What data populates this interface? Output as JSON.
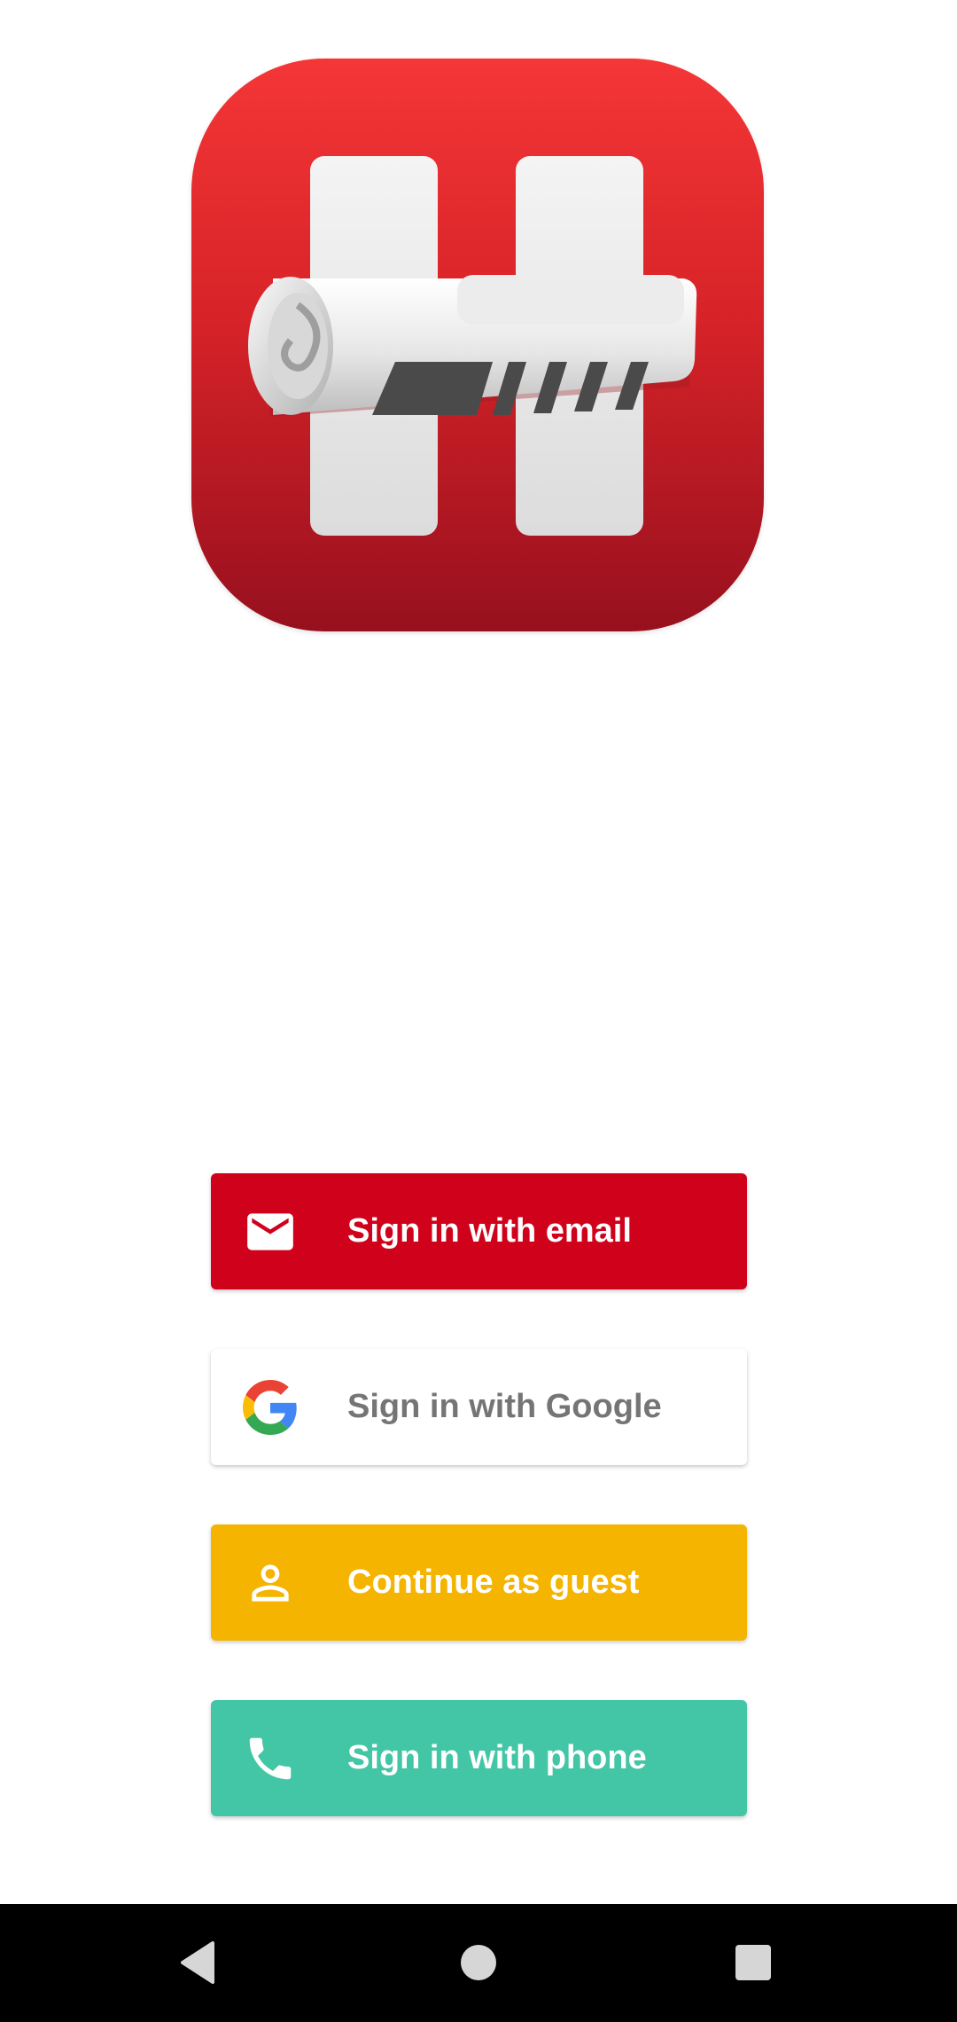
{
  "logo": {
    "icon": "newspaper-logo-icon",
    "background_color": "#e02a2e"
  },
  "auth_buttons": [
    {
      "label": "Sign in with email",
      "icon": "email-icon",
      "color": "#d0021b"
    },
    {
      "label": "Sign in with Google",
      "icon": "google-icon",
      "color": "#ffffff"
    },
    {
      "label": "Continue as guest",
      "icon": "person-icon",
      "color": "#f4b400"
    },
    {
      "label": "Sign in with phone",
      "icon": "phone-icon",
      "color": "#43c6a5"
    }
  ],
  "navigation_bar": {
    "icons": [
      "back-icon",
      "home-icon",
      "recents-icon"
    ]
  }
}
